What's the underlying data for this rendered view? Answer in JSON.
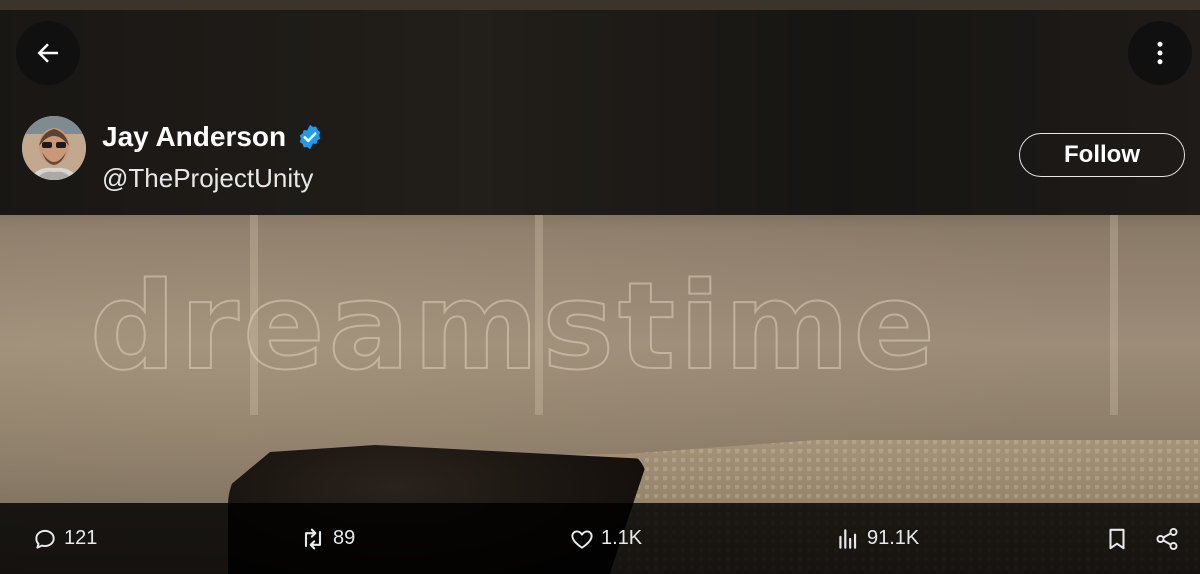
{
  "post": {
    "author_name": "Jay Anderson",
    "handle": "@TheProjectUnity",
    "verified": true,
    "follow_label": "Follow",
    "watermark": "dreamstime"
  },
  "actions": {
    "replies": "121",
    "reposts": "89",
    "likes": "1.1K",
    "views": "91.1K"
  },
  "icons": {
    "back": "arrow-left-icon",
    "more": "more-vertical-icon",
    "verified": "verified-badge-icon",
    "reply": "reply-icon",
    "repost": "repost-icon",
    "like": "heart-icon",
    "views": "views-bar-chart-icon",
    "bookmark": "bookmark-icon",
    "share": "share-icon"
  },
  "colors": {
    "verified": "#1d9bf0",
    "text": "#e7e9ea",
    "overlay": "#000000"
  }
}
